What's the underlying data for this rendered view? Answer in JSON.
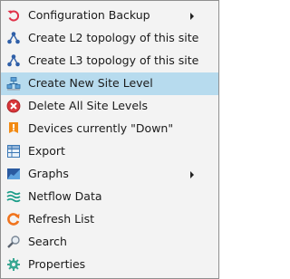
{
  "menu": {
    "items": [
      {
        "label": "Configuration Backup",
        "icon": "undo-icon",
        "submenu": true
      },
      {
        "label": "Create L2 topology of this site",
        "icon": "topology-icon"
      },
      {
        "label": "Create L3 topology of this site",
        "icon": "topology-icon"
      },
      {
        "label": "Create New Site Level",
        "icon": "site-level-icon",
        "highlighted": true
      },
      {
        "label": "Delete All Site Levels",
        "icon": "delete-icon"
      },
      {
        "label": "Devices currently \"Down\"",
        "icon": "alert-icon"
      },
      {
        "label": "Export",
        "icon": "export-icon"
      },
      {
        "label": "Graphs",
        "icon": "graph-icon",
        "submenu": true
      },
      {
        "label": "Netflow Data",
        "icon": "netflow-icon"
      },
      {
        "label": "Refresh List",
        "icon": "refresh-icon"
      },
      {
        "label": "Search",
        "icon": "search-icon"
      },
      {
        "label": "Properties",
        "icon": "gear-icon"
      }
    ]
  },
  "colors": {
    "highlight": "#b7dbee",
    "menu_background": "#f3f3f3",
    "border": "#8f8f8f"
  }
}
